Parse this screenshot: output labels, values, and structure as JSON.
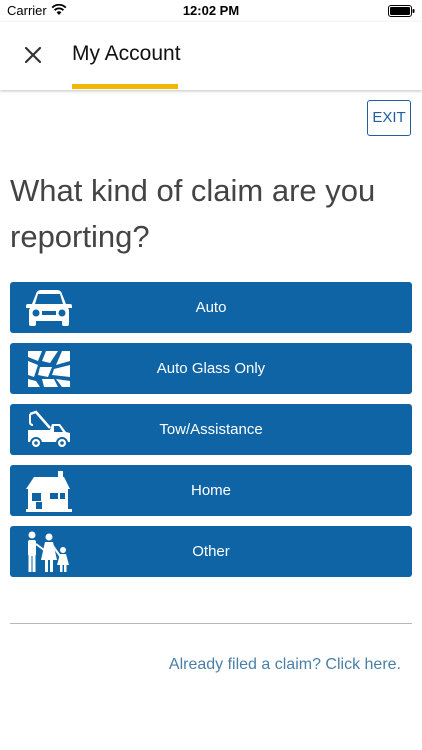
{
  "status_bar": {
    "carrier": "Carrier",
    "time": "12:02 PM"
  },
  "header": {
    "title": "My Account",
    "accent_color": "#f2b705"
  },
  "exit_label": "EXIT",
  "question": "What kind of claim are you reporting?",
  "claim_types": [
    {
      "label": "Auto",
      "icon": "car-icon"
    },
    {
      "label": "Auto Glass Only",
      "icon": "broken-glass-icon"
    },
    {
      "label": "Tow/Assistance",
      "icon": "tow-truck-icon"
    },
    {
      "label": "Home",
      "icon": "house-icon"
    },
    {
      "label": "Other",
      "icon": "family-icon"
    }
  ],
  "footer_link": "Already filed a claim? Click here.",
  "colors": {
    "button_bg": "#0f64a6",
    "link": "#4a7fa8"
  }
}
